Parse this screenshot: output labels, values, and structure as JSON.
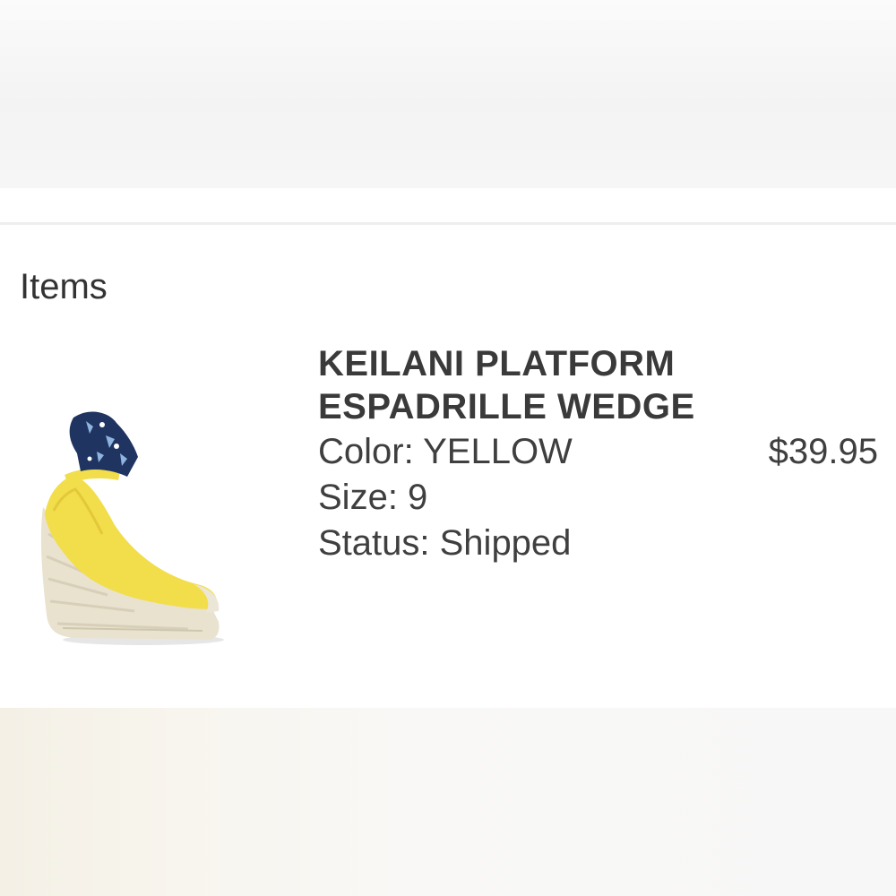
{
  "items_section": {
    "title": "Items"
  },
  "item": {
    "name_line1": "KEILANI PLATFORM",
    "name_line2": "ESPADRILLE WEDGE",
    "color_text": "Color: YELLOW",
    "size_text": "Size: 9",
    "status_text": "Status: Shipped",
    "price": "$39.95",
    "image": {
      "icon": "espadrille-wedge-shoe",
      "colors": {
        "upper": "#f2dd4a",
        "wedge": "#e9e2cf",
        "scarf": "#1f3461"
      }
    }
  }
}
